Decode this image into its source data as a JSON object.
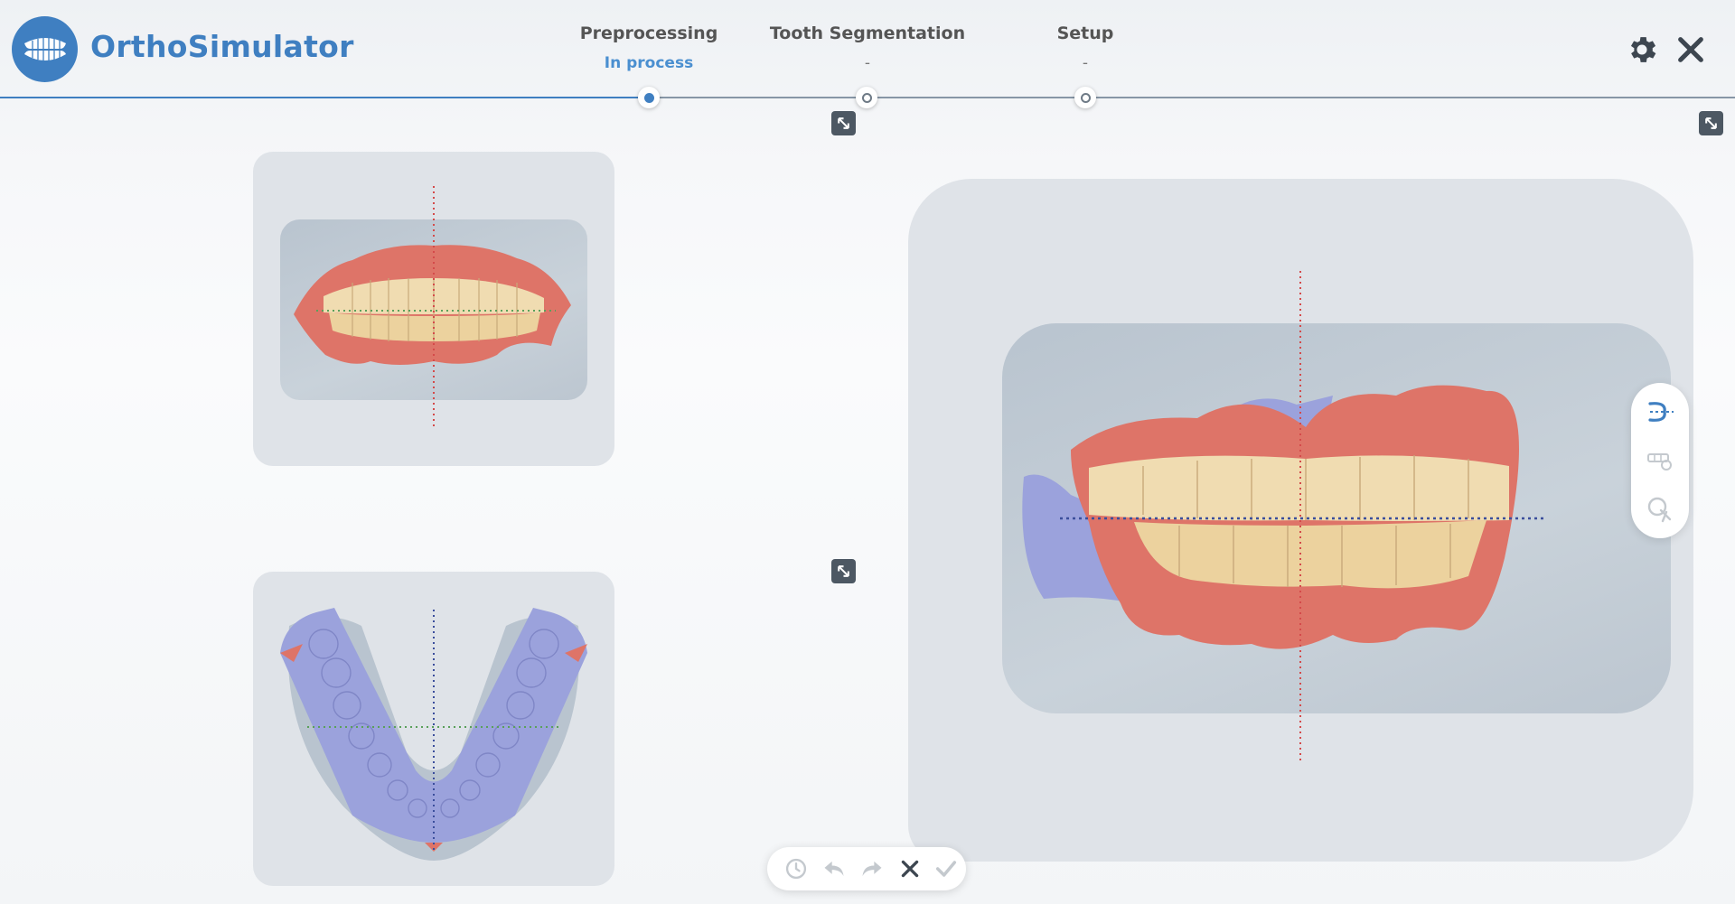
{
  "app": {
    "title": "OrthoSimulator"
  },
  "steps": [
    {
      "name": "Preprocessing",
      "status": "In process"
    },
    {
      "name": "Tooth Segmentation",
      "status": "-"
    },
    {
      "name": "Setup",
      "status": "-"
    }
  ],
  "colors": {
    "accent": "#3f7fc1",
    "gum": "#e0786c",
    "tooth": "#f2e0b8",
    "scan": "#9ba2dc",
    "axis_red": "#d44a4a",
    "axis_blue": "#3b4e9c",
    "axis_green": "#5aa05a"
  },
  "views": [
    {
      "id": "front",
      "content": "front-view-dental-scan"
    },
    {
      "id": "occlusal",
      "content": "occlusal-view-lower-arch"
    },
    {
      "id": "lateral",
      "content": "lateral-view-dental-scan"
    }
  ],
  "tools": [
    "cut-plane-icon",
    "tooth-gear-icon",
    "brush-icon"
  ],
  "bottom_toolbar": [
    "history-icon",
    "undo-icon",
    "redo-icon",
    "cancel-icon",
    "confirm-icon"
  ],
  "header_icons": [
    "gear-icon",
    "close-icon"
  ]
}
